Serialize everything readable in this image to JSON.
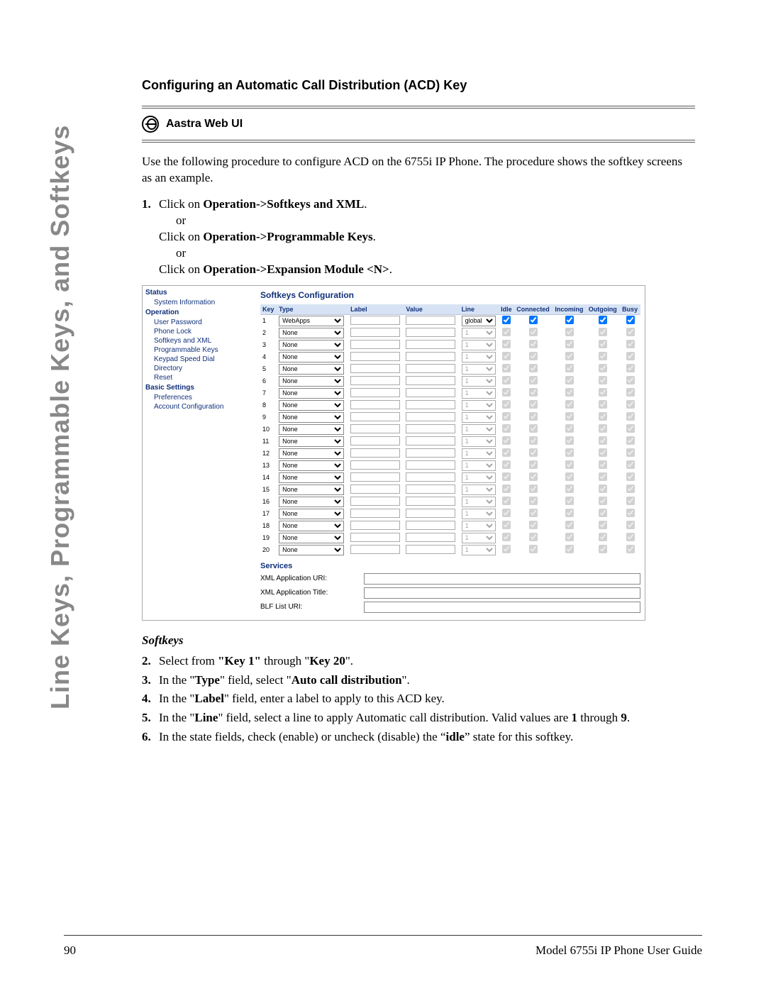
{
  "vertical_tab": "Line Keys, Programmable Keys, and Softkeys",
  "section_title": "Configuring an Automatic Call Distribution (ACD) Key",
  "section_header": "Aastra Web UI",
  "intro": "Use the following procedure to configure ACD on the 6755i IP Phone. The procedure shows the softkey screens as an example.",
  "step1": {
    "prefix": "Click on ",
    "path1": "Operation->Softkeys and XML",
    "or": "or",
    "path2": "Operation->Programmable Keys",
    "path3": "Operation->Expansion Module <N>"
  },
  "ui": {
    "sidebar": {
      "headers": [
        "Status",
        "Operation",
        "Basic Settings"
      ],
      "status_items": [
        "System Information"
      ],
      "operation_items": [
        "User Password",
        "Phone Lock",
        "Softkeys and XML",
        "Programmable Keys",
        "Keypad Speed Dial",
        "Directory",
        "Reset"
      ],
      "basic_items": [
        "Preferences",
        "Account Configuration"
      ]
    },
    "panel_title": "Softkeys Configuration",
    "columns": [
      "Key",
      "Type",
      "Label",
      "Value",
      "Line",
      "Idle",
      "Connected",
      "Incoming",
      "Outgoing",
      "Busy"
    ],
    "rows": [
      {
        "key": "1",
        "type": "WebApps",
        "line": "global",
        "idle": true,
        "connected": true,
        "incoming": true,
        "outgoing": true,
        "busy": true,
        "enabled": true
      },
      {
        "key": "2",
        "type": "None",
        "line": "1",
        "idle": true,
        "connected": true,
        "incoming": true,
        "outgoing": true,
        "busy": true,
        "enabled": false
      },
      {
        "key": "3",
        "type": "None",
        "line": "1",
        "idle": true,
        "connected": true,
        "incoming": true,
        "outgoing": true,
        "busy": true,
        "enabled": false
      },
      {
        "key": "4",
        "type": "None",
        "line": "1",
        "idle": true,
        "connected": true,
        "incoming": true,
        "outgoing": true,
        "busy": true,
        "enabled": false
      },
      {
        "key": "5",
        "type": "None",
        "line": "1",
        "idle": true,
        "connected": true,
        "incoming": true,
        "outgoing": true,
        "busy": true,
        "enabled": false
      },
      {
        "key": "6",
        "type": "None",
        "line": "1",
        "idle": true,
        "connected": true,
        "incoming": true,
        "outgoing": true,
        "busy": true,
        "enabled": false
      },
      {
        "key": "7",
        "type": "None",
        "line": "1",
        "idle": true,
        "connected": true,
        "incoming": true,
        "outgoing": true,
        "busy": true,
        "enabled": false
      },
      {
        "key": "8",
        "type": "None",
        "line": "1",
        "idle": true,
        "connected": true,
        "incoming": true,
        "outgoing": true,
        "busy": true,
        "enabled": false
      },
      {
        "key": "9",
        "type": "None",
        "line": "1",
        "idle": true,
        "connected": true,
        "incoming": true,
        "outgoing": true,
        "busy": true,
        "enabled": false
      },
      {
        "key": "10",
        "type": "None",
        "line": "1",
        "idle": true,
        "connected": true,
        "incoming": true,
        "outgoing": true,
        "busy": true,
        "enabled": false
      },
      {
        "key": "11",
        "type": "None",
        "line": "1",
        "idle": true,
        "connected": true,
        "incoming": true,
        "outgoing": true,
        "busy": true,
        "enabled": false
      },
      {
        "key": "12",
        "type": "None",
        "line": "1",
        "idle": true,
        "connected": true,
        "incoming": true,
        "outgoing": true,
        "busy": true,
        "enabled": false
      },
      {
        "key": "13",
        "type": "None",
        "line": "1",
        "idle": true,
        "connected": true,
        "incoming": true,
        "outgoing": true,
        "busy": true,
        "enabled": false
      },
      {
        "key": "14",
        "type": "None",
        "line": "1",
        "idle": true,
        "connected": true,
        "incoming": true,
        "outgoing": true,
        "busy": true,
        "enabled": false
      },
      {
        "key": "15",
        "type": "None",
        "line": "1",
        "idle": true,
        "connected": true,
        "incoming": true,
        "outgoing": true,
        "busy": true,
        "enabled": false
      },
      {
        "key": "16",
        "type": "None",
        "line": "1",
        "idle": true,
        "connected": true,
        "incoming": true,
        "outgoing": true,
        "busy": true,
        "enabled": false
      },
      {
        "key": "17",
        "type": "None",
        "line": "1",
        "idle": true,
        "connected": true,
        "incoming": true,
        "outgoing": true,
        "busy": true,
        "enabled": false
      },
      {
        "key": "18",
        "type": "None",
        "line": "1",
        "idle": true,
        "connected": true,
        "incoming": true,
        "outgoing": true,
        "busy": true,
        "enabled": false
      },
      {
        "key": "19",
        "type": "None",
        "line": "1",
        "idle": true,
        "connected": true,
        "incoming": true,
        "outgoing": true,
        "busy": true,
        "enabled": false
      },
      {
        "key": "20",
        "type": "None",
        "line": "1",
        "idle": true,
        "connected": true,
        "incoming": true,
        "outgoing": true,
        "busy": true,
        "enabled": false
      }
    ],
    "services_header": "Services",
    "services": [
      {
        "label": "XML Application URI:",
        "value": ""
      },
      {
        "label": "XML Application Title:",
        "value": ""
      },
      {
        "label": "BLF List URI:",
        "value": ""
      }
    ]
  },
  "subheader": "Softkeys",
  "steps2": {
    "s2_a": "Select from ",
    "s2_b1": "\"Key 1\"",
    "s2_c": " through \"",
    "s2_b2": "Key 20",
    "s2_d": "\".",
    "s3_a": "In the \"",
    "s3_b": "Type",
    "s3_c": "\" field, select \"",
    "s3_d": "Auto call distribution",
    "s3_e": "\".",
    "s4_a": "In the \"",
    "s4_b": "Label",
    "s4_c": "\" field, enter a label to apply to this ACD key.",
    "s5_a": "In the \"",
    "s5_b": "Line",
    "s5_c": "\" field, select a line to apply Automatic call distribution. Valid values are ",
    "s5_d": "1",
    "s5_e": " through ",
    "s5_f": "9",
    "s5_g": ".",
    "s6_a": "In the state fields, check (enable) or uncheck (disable) the “",
    "s6_b": "idle",
    "s6_c": "” state for this softkey."
  },
  "footer": {
    "page": "90",
    "title": "Model 6755i IP Phone User Guide"
  }
}
